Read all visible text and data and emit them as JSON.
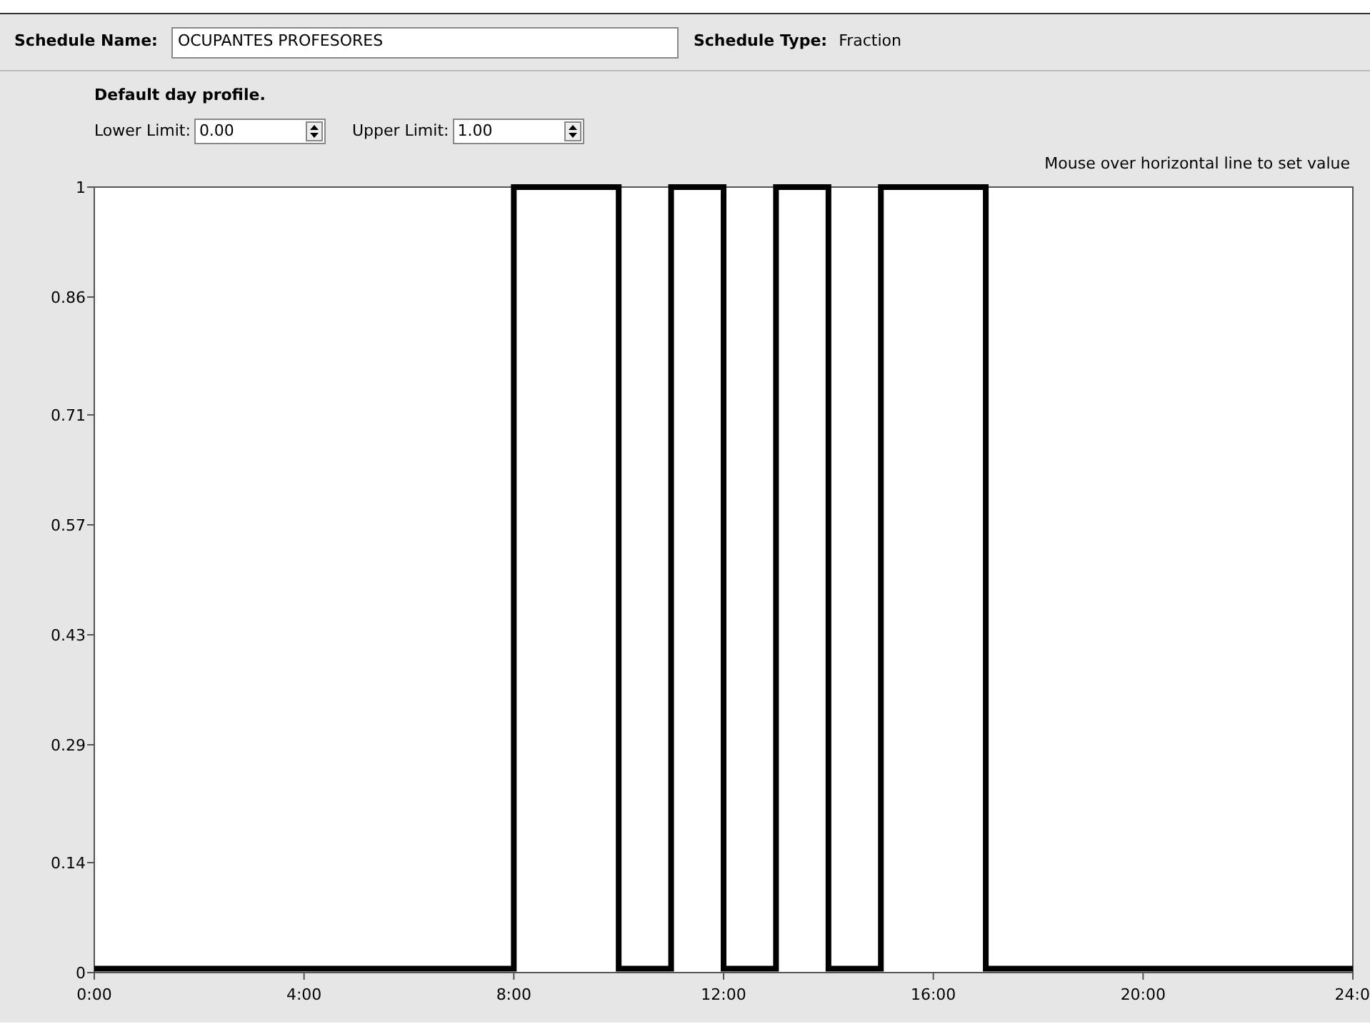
{
  "schedule_name": {
    "label": "Schedule Name:",
    "value": "OCUPANTES PROFESORES"
  },
  "schedule_type": {
    "label": "Schedule Type:",
    "value": "Fraction"
  },
  "profile_title": "Default day profile.",
  "limits": [
    {
      "label": "Lower Limit:",
      "value": "0.00"
    },
    {
      "label": "Upper Limit:",
      "value": "1.00"
    }
  ],
  "hint": "Mouse over horizontal line to set value",
  "chart_data": {
    "type": "line",
    "x": [
      0,
      8,
      8,
      10,
      10,
      11,
      11,
      12,
      12,
      13,
      13,
      14,
      14,
      15,
      15,
      17,
      17,
      24
    ],
    "series": [
      {
        "color": "#000000",
        "values": [
          0.005,
          0.005,
          1,
          1,
          0.005,
          0.005,
          1,
          1,
          0.005,
          0.005,
          1,
          1,
          0.005,
          0.005,
          1,
          1,
          0.005,
          0.005
        ]
      }
    ],
    "xlim": [
      0,
      24
    ],
    "ylim": [
      0,
      1
    ],
    "xticks": [
      {
        "value": 0,
        "label": "0:00"
      },
      {
        "value": 4,
        "label": "4:00"
      },
      {
        "value": 8,
        "label": "8:00"
      },
      {
        "value": 12,
        "label": "12:00"
      },
      {
        "value": 16,
        "label": "16:00"
      },
      {
        "value": 20,
        "label": "20:00"
      },
      {
        "value": 24,
        "label": "24:0"
      }
    ],
    "yticks": [
      {
        "value": 0,
        "label": "0"
      },
      {
        "value": 0.14,
        "label": "0.14"
      },
      {
        "value": 0.29,
        "label": "0.29"
      },
      {
        "value": 0.43,
        "label": "0.43"
      },
      {
        "value": 0.57,
        "label": "0.57"
      },
      {
        "value": 0.71,
        "label": "0.71"
      },
      {
        "value": 0.86,
        "label": "0.86"
      },
      {
        "value": 1,
        "label": "1"
      }
    ]
  }
}
